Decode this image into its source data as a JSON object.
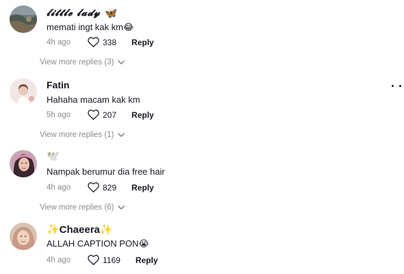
{
  "comments": [
    {
      "username": "𝓵𝓲𝓽𝓽𝓵𝓮 𝓵𝓪𝓭𝔂",
      "username_badge": "🦋",
      "avatar": "landscape-avatar",
      "text": "memati ingt kak km😂",
      "time": "4h ago",
      "likes": "338",
      "reply_label": "Reply",
      "view_more": "View more replies (3)"
    },
    {
      "username": "Fatin",
      "avatar": "girl-avatar",
      "text": "Hahaha macam kak km",
      "time": "5h ago",
      "likes": "207",
      "reply_label": "Reply",
      "view_more": "View more replies (1)"
    },
    {
      "username": "🕊️",
      "avatar": "woman-avatar",
      "text": "Nampak berumur dia free hair",
      "time": "4h ago",
      "likes": "829",
      "reply_label": "Reply",
      "view_more": "View more replies (6)"
    },
    {
      "username": "✨Chaeera✨",
      "avatar": "hijab-avatar",
      "text": "ALLAH CAPTION PON😭",
      "time": "4h ago",
      "likes": "1169",
      "reply_label": "Reply"
    }
  ],
  "icons": {
    "like": "heart-outline-icon",
    "expand": "chevron-down-icon",
    "more": "more-options-icon"
  },
  "colors": {
    "text_primary": "#161823",
    "text_secondary": "#8a8b91"
  }
}
